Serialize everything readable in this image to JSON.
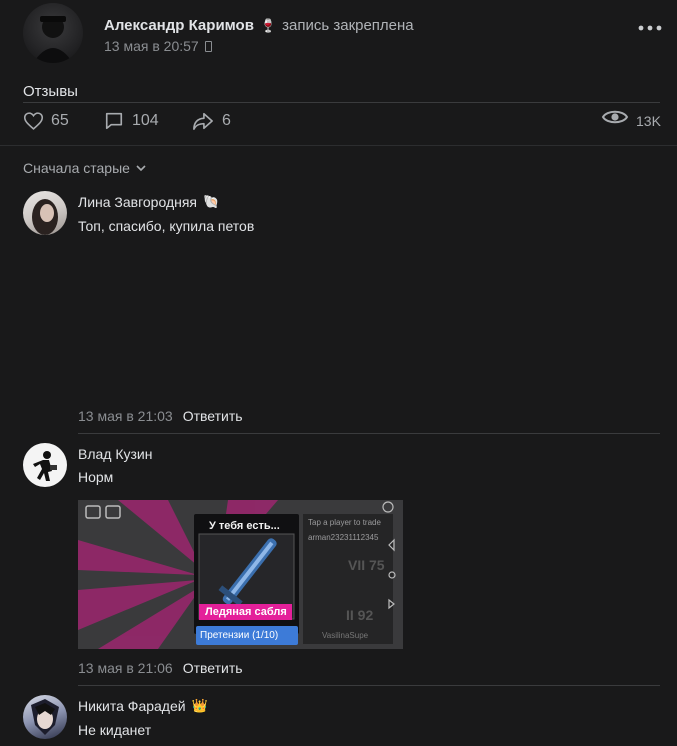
{
  "post": {
    "author": "Александр Каримов",
    "author_emoji": "🍷",
    "pinned_label": "запись закреплена",
    "date": "13 мая в 20:57",
    "text": "Отзывы",
    "likes": "65",
    "comments": "104",
    "shares": "6",
    "views": "13K"
  },
  "comments_sort": {
    "label": "Сначала старые"
  },
  "comments": [
    {
      "author": "Лина Завгородняя",
      "author_emoji": "🐚",
      "text": "Топ, спасибо, купила петов",
      "date": "13 мая в 21:03",
      "reply": "Ответить"
    },
    {
      "author": "Влад Кузин",
      "text": "Норм",
      "date": "13 мая в 21:06",
      "reply": "Ответить",
      "attachment": {
        "dialog_title": "У тебя есть...",
        "item_name": "Ледяная сабля",
        "button_label": "Претензии (1/10)",
        "trade_title": "Tap a player to trade",
        "player1": "arman23231112345",
        "player1_level": "VII 75",
        "player2": "VasilinaSupe",
        "player2_level": "II 92"
      }
    },
    {
      "author": "Никита Фарадей",
      "author_emoji": "👑",
      "text": "Не киданет"
    }
  ],
  "colors": {
    "background": "#19191a",
    "text": "#e1e3e6",
    "muted": "#8a8d91",
    "divider": "#3a3b3d",
    "accent_pink": "#e4209a"
  }
}
